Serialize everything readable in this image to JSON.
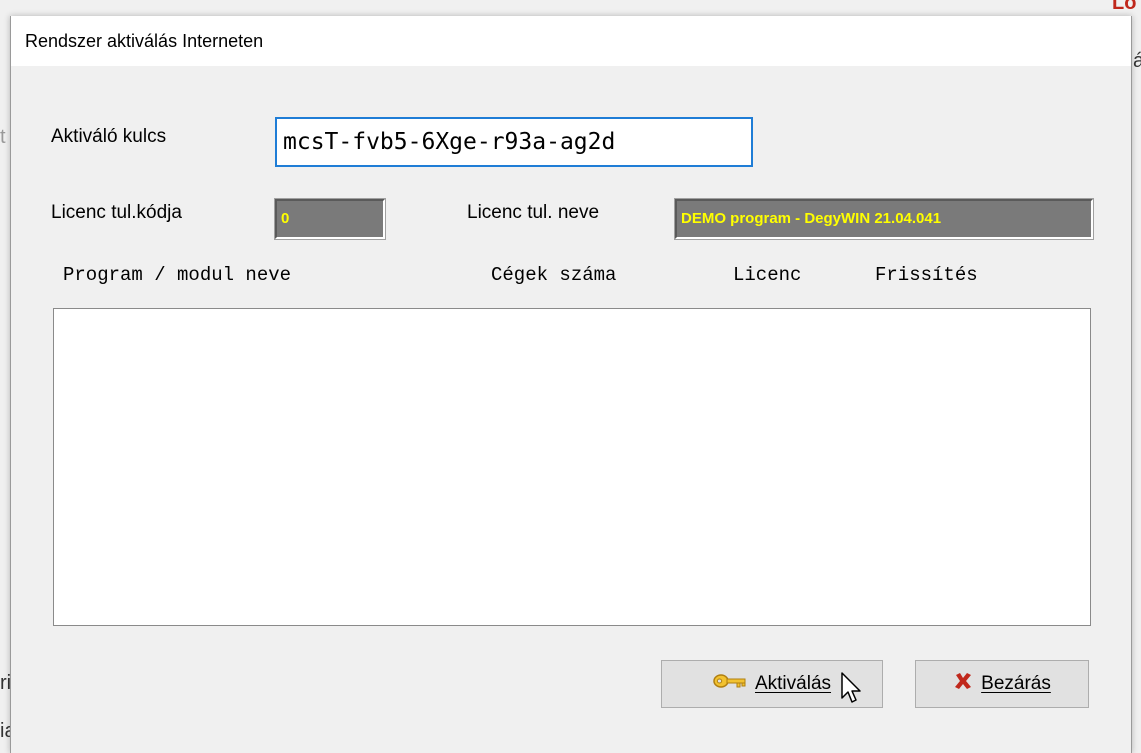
{
  "background": {
    "fragments": [
      "Lö",
      "á",
      "t",
      "ri",
      "ia"
    ]
  },
  "dialog": {
    "title": "Rendszer aktiválás Interneten",
    "activation_key_label": "Aktiváló kulcs",
    "activation_key_value": "mcsT-fvb5-6Xge-r93a-ag2d",
    "licence_code_label": "Licenc tul.kódja",
    "licence_code_value": "0",
    "licence_name_label": "Licenc tul. neve",
    "licence_name_value": "DEMO program - DegyWIN 21.04.041",
    "columns": [
      "Program / modul neve",
      "Cégek száma",
      "Licenc",
      "Frissítés"
    ],
    "rows": [],
    "buttons": {
      "activate_label": "Aktiválás",
      "activate_icon": "key-icon",
      "close_label": "Bezárás",
      "close_icon": "close-x-icon"
    }
  },
  "colors": {
    "readonly_bg": "#7a7a7a",
    "readonly_text": "#ffff00",
    "focus_border": "#1f7dd6",
    "close_x": "#c0281c"
  }
}
